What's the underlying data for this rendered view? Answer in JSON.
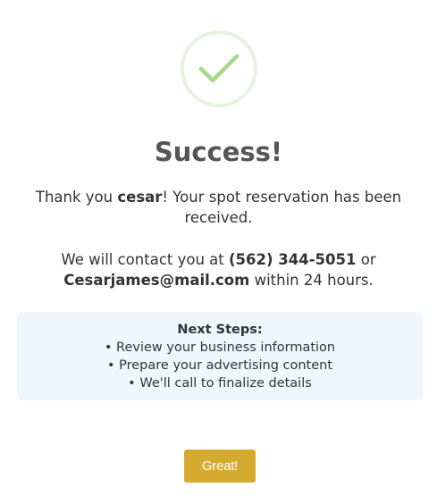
{
  "icon": "checkmark-icon",
  "colors": {
    "check": "#a4d98a",
    "circle_border": "#e6f4dd",
    "steps_bg": "#eff7fe",
    "button_bg": "#d4ab2f",
    "button_text": "#ffffff"
  },
  "title": "Success!",
  "message1": {
    "prefix": "Thank you ",
    "name": "cesar",
    "suffix": "! Your spot reservation has been received."
  },
  "message2": {
    "prefix": "We will contact you at ",
    "phone": "(562) 344-5051",
    "middle": " or ",
    "email": "Cesarjames@mail.com",
    "suffix": " within 24 hours."
  },
  "next_steps": {
    "title": "Next Steps:",
    "items": [
      "• Review your business information",
      "• Prepare your advertising content",
      "• We'll call to finalize details"
    ]
  },
  "button": {
    "label": "Great!"
  }
}
